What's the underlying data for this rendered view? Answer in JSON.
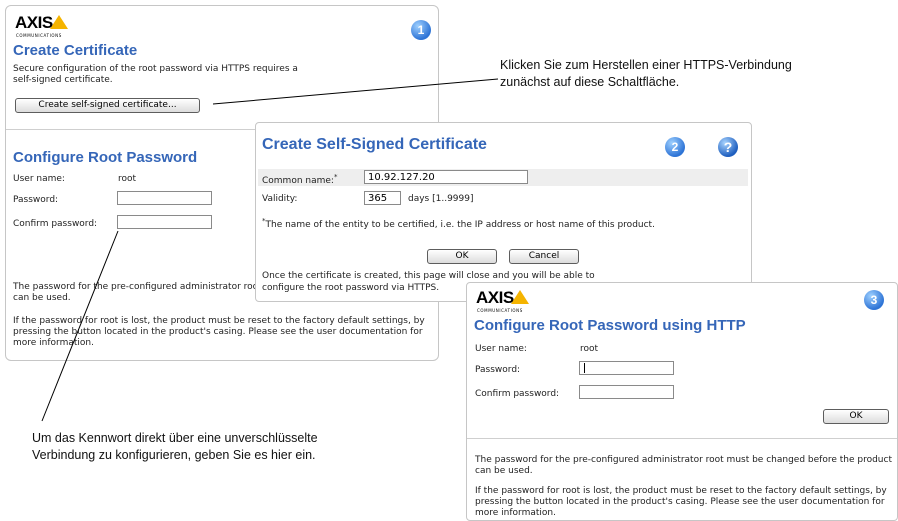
{
  "brand": {
    "logo_text": "AXIS",
    "logo_sub": "COMMUNICATIONS"
  },
  "panel1": {
    "step": "1",
    "title": "Create Certificate",
    "description": "Secure configuration of the root password via HTTPS requires a self-signed certificate.",
    "create_button": "Create self-signed certificate...",
    "root_title": "Configure Root Password",
    "username_label": "User name:",
    "username_value": "root",
    "password_label": "Password:",
    "confirm_label": "Confirm password:",
    "note1": "The password for the pre-configured administrator root must be changed before the product can be used.",
    "note2": "If the password for root is lost, the product must be reset to the factory default settings, by pressing the button located in the product's casing. Please see the user documentation for more information."
  },
  "panel2": {
    "step": "2",
    "help": "?",
    "title": "Create Self-Signed Certificate",
    "common_name_label": "Common name:",
    "required_mark": "*",
    "common_name_value": "10.92.127.20",
    "validity_label": "Validity:",
    "validity_value": "365",
    "validity_unit": "days [1..9999]",
    "footnote": "The name of the entity to be certified, i.e. the IP address or host name of this product.",
    "ok_button": "OK",
    "cancel_button": "Cancel",
    "info_line1": "Once the certificate is created, this page will close and you will be able to",
    "info_line2": "configure the root password via HTTPS."
  },
  "panel3": {
    "step": "3",
    "title": "Configure Root Password using HTTP",
    "username_label": "User name:",
    "username_value": "root",
    "password_label": "Password:",
    "confirm_label": "Confirm password:",
    "ok_button": "OK",
    "note1": "The password for the pre-configured administrator root must be changed before the product can be used.",
    "note2": "If the password for root is lost, the product must be reset to the factory default settings, by pressing the button located in the product's casing. Please see the user documentation for more information."
  },
  "callouts": {
    "https": "Klicken Sie zum Herstellen einer HTTPS-Verbindung zunächst auf diese Schaltfläche.",
    "http": "Um das Kennwort direkt über eine unverschlüsselte Verbindung zu konfigurieren, geben Sie es hier ein."
  },
  "colors": {
    "title_blue": "#3566b8",
    "logo_yellow": "#f5b400",
    "step_blue": "#2e74d6"
  }
}
